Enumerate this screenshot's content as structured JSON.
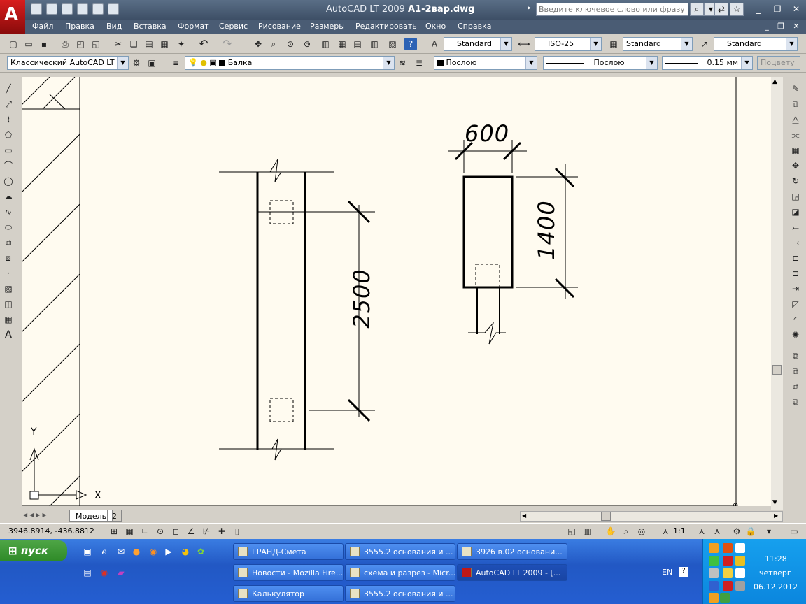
{
  "window": {
    "app_title": "AutoCAD LT 2009",
    "file_name": "A1-2вар.dwg",
    "search_placeholder": "Введите ключевое слово или фразу"
  },
  "menu": [
    "Файл",
    "Правка",
    "Вид",
    "Вставка",
    "Формат",
    "Сервис",
    "Рисование",
    "Размеры",
    "Редактировать",
    "Окно",
    "Справка"
  ],
  "styles": {
    "text_style": "Standard",
    "dim_style": "ISO-25",
    "table_style": "Standard",
    "mleader_style": "Standard"
  },
  "workspace": "Классический AutoCAD LT",
  "layer": "Балка",
  "properties": {
    "color": "Послою",
    "linetype": "Послою",
    "lineweight": "0.15 мм",
    "plotstyle": "Поцвету"
  },
  "drawing": {
    "dim_width": "600",
    "dim_height": "1400",
    "dim_length": "2500",
    "ucs_x": "X",
    "ucs_y": "Y"
  },
  "tabs": [
    "Модель",
    "2"
  ],
  "status": {
    "coords": "3946.8914, -436.8812",
    "scale": "1:1"
  },
  "taskbar": {
    "start_label": "пуск",
    "tasks": [
      "ГРАНД-Смета",
      "3555.2 основания и ...",
      "3926 в.02 основани...",
      "Новости - Mozilla Fire...",
      "схема и разрез - Micr...",
      "AutoCAD LT 2009 - [...",
      "Калькулятор",
      "3555.2 основания и ..."
    ],
    "lang": "EN",
    "time": "11:28",
    "day": "четверг",
    "date": "06.12.2012"
  },
  "colors": {
    "title_bg": "#3e4f66",
    "canvas_bg": "#fffbf0",
    "taskbar_bg": "#245ed1"
  }
}
